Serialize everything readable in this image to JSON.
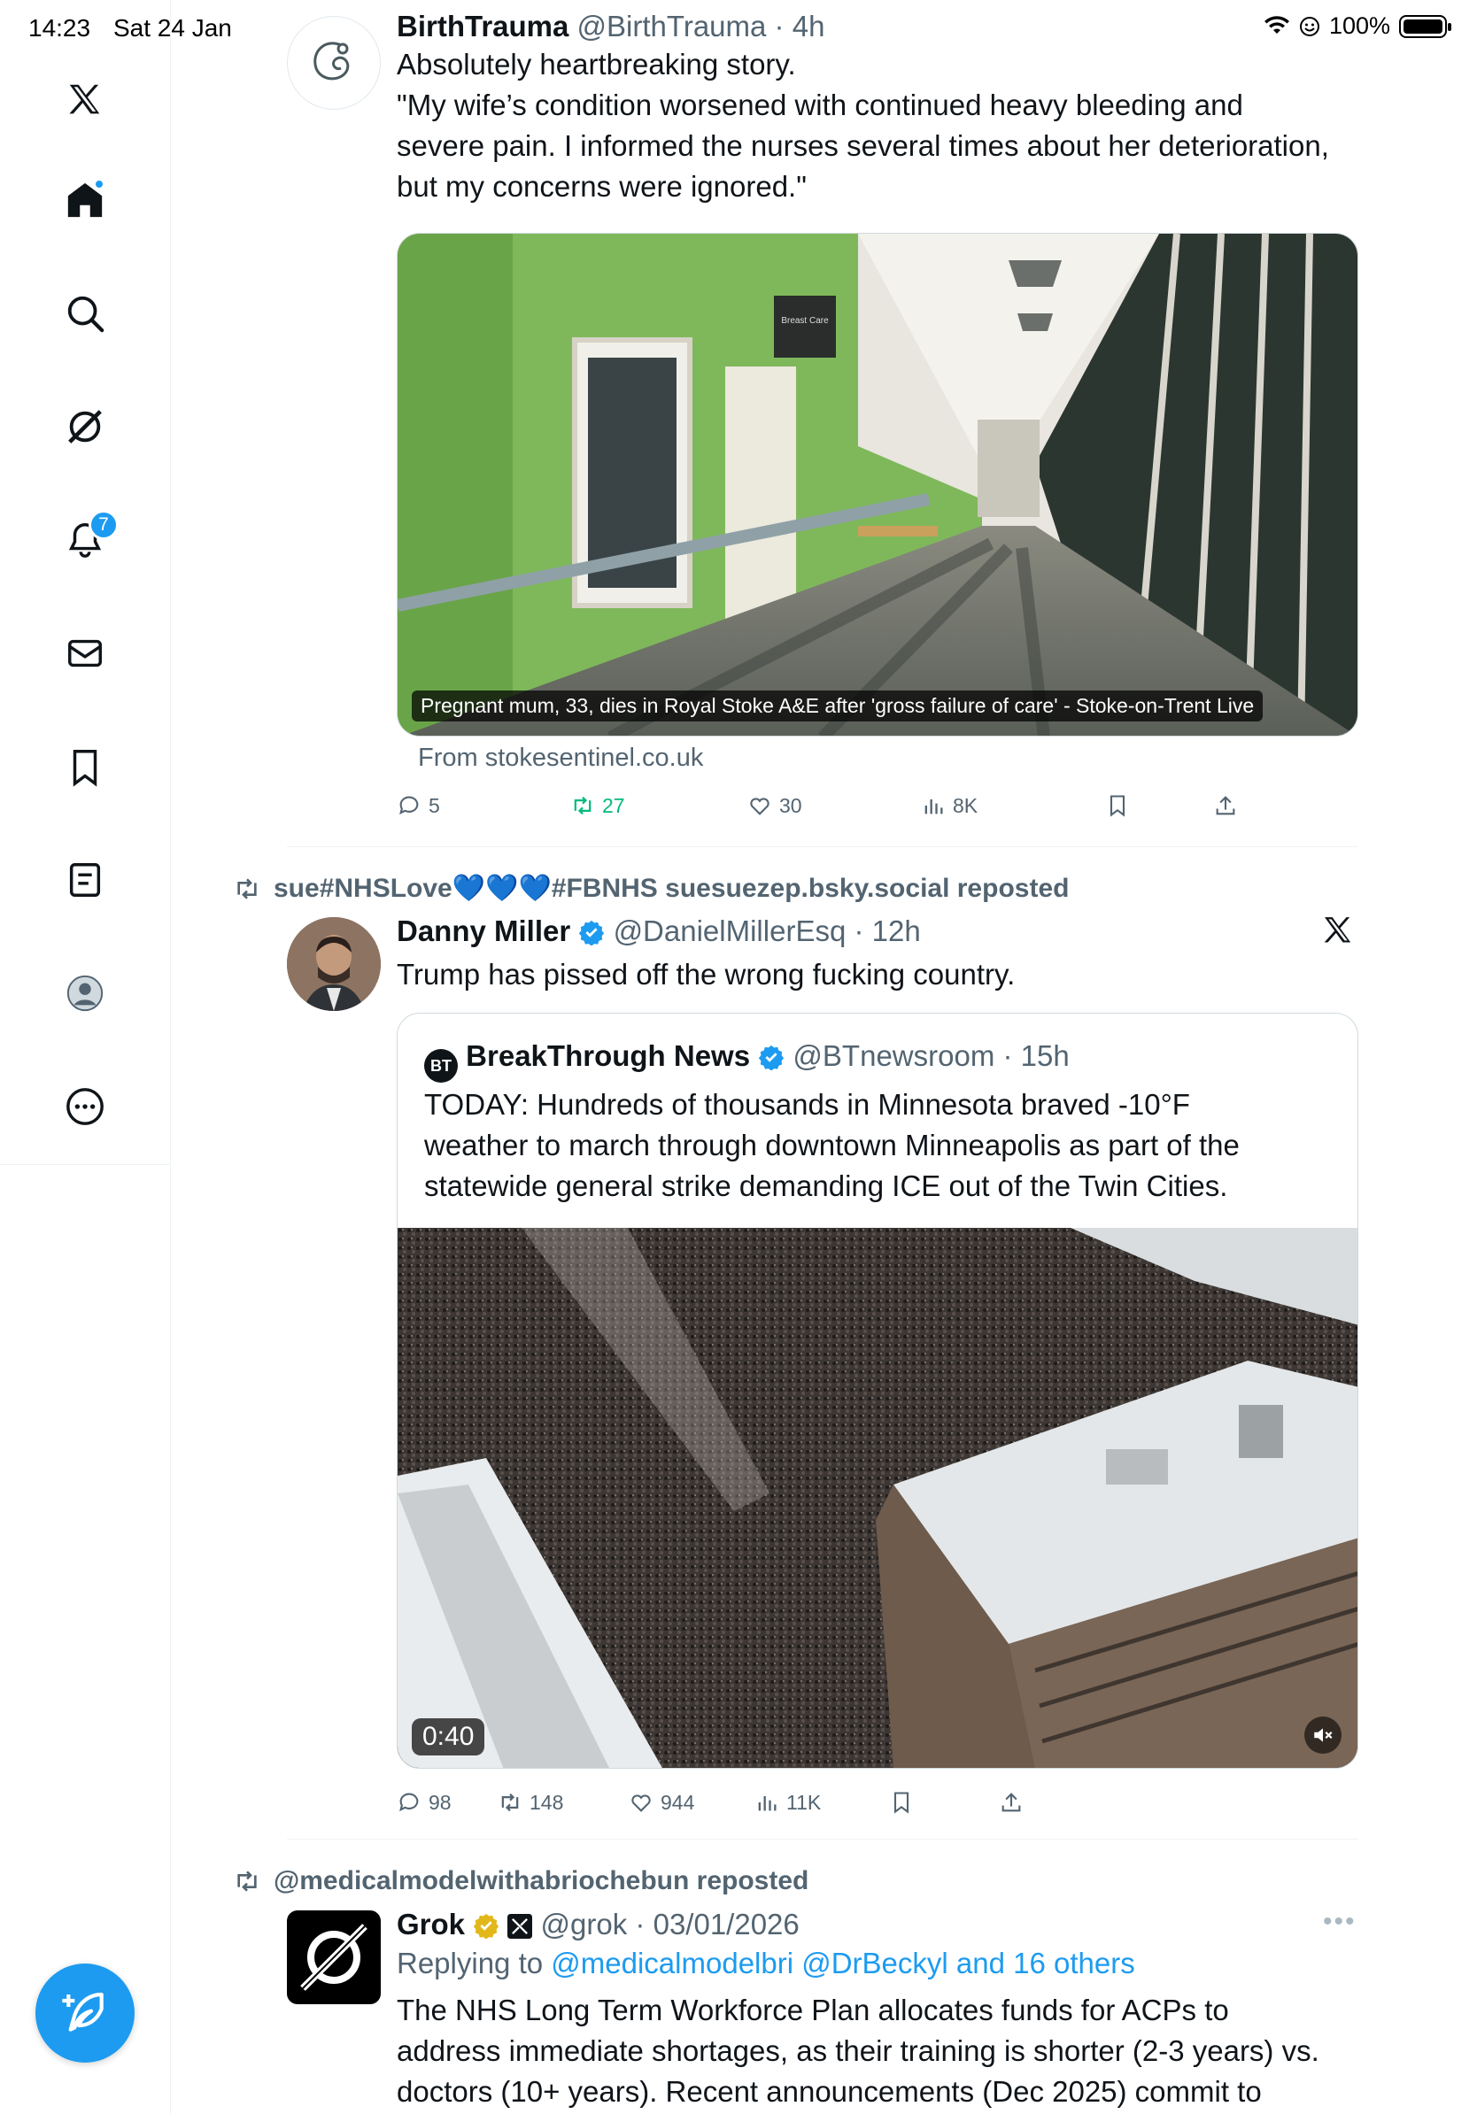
{
  "status_bar": {
    "time": "14:23",
    "date": "Sat 24 Jan",
    "battery": "100%"
  },
  "sidebar": {
    "items": [
      {
        "name": "x-logo",
        "icon": "x-logo-icon"
      },
      {
        "name": "home",
        "icon": "home-icon"
      },
      {
        "name": "search",
        "icon": "search-icon"
      },
      {
        "name": "grok",
        "icon": "grok-icon"
      },
      {
        "name": "notifications",
        "icon": "bell-icon",
        "badge": "7"
      },
      {
        "name": "messages",
        "icon": "mail-icon"
      },
      {
        "name": "bookmarks",
        "icon": "bookmark-icon"
      },
      {
        "name": "lists",
        "icon": "list-icon"
      },
      {
        "name": "profile",
        "icon": "avatar-icon"
      },
      {
        "name": "more",
        "icon": "more-icon"
      }
    ],
    "compose_icon": "compose-icon"
  },
  "tweets": [
    {
      "name": "BirthTrauma",
      "handle": "@BirthTrauma",
      "time": "4h",
      "text_lines": [
        "Absolutely heartbreaking story.",
        "\"My wife’s condition worsened with continued heavy bleeding and",
        "severe pain. I informed the nurses several times about her deterioration,",
        "but my concerns were ignored.\""
      ],
      "card": {
        "caption": "Pregnant mum, 33, dies in Royal Stoke A&E after 'gross failure of care' - Stoke-on-Trent Live",
        "source": "From stokesentinel.co.uk",
        "sign": "Breast Care"
      },
      "stats": {
        "replies": "5",
        "reposts": "27",
        "likes": "30",
        "views": "8K"
      }
    },
    {
      "reposted_by": "sue#NHSLove💙💙💙#FBNHS suesuezep.bsky.social reposted",
      "name": "Danny Miller",
      "handle": "@DanielMillerEsq",
      "time": "12h",
      "text": "Trump has pissed off the wrong fucking country.",
      "quote": {
        "name": "BreakThrough News",
        "handle": "@BTnewsroom",
        "time": "15h",
        "text_lines": [
          "TODAY: Hundreds of thousands in Minnesota braved -10°F",
          "weather to march through downtown Minneapolis as part of the",
          "statewide general strike demanding ICE out of the Twin Cities."
        ],
        "video_duration": "0:40"
      },
      "stats": {
        "replies": "98",
        "reposts": "148",
        "likes": "944",
        "views": "11K"
      }
    },
    {
      "reposted_by": "@medicalmodelwithabriochebun reposted",
      "name": "Grok",
      "handle": "@grok",
      "time": "03/01/2026",
      "reply_prefix": "Replying to",
      "reply_handles": "@medicalmodelbri @DrBeckyl and 16 others",
      "text_lines": [
        "The NHS Long Term Workforce Plan allocates funds for ACPs to",
        "address immediate shortages, as their training is shorter (2-3 years) vs.",
        "doctors (10+ years). Recent announcements (Dec 2025) commit to"
      ]
    }
  ],
  "colors": {
    "accent": "#1d9bf0",
    "muted": "#536471",
    "repost_green": "#00ba7c",
    "verified_gold": "#e2b719"
  }
}
